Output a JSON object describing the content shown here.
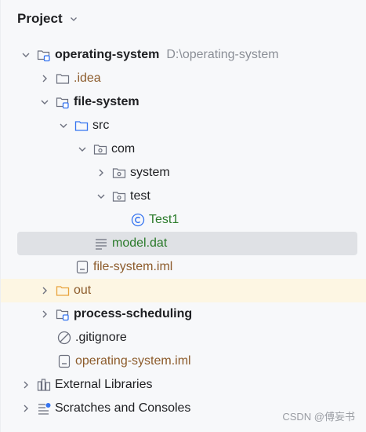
{
  "header": {
    "title": "Project"
  },
  "tree": {
    "root_label": "operating-system",
    "root_path": "D:\\operating-system",
    "idea_label": ".idea",
    "filesystem_label": "file-system",
    "src_label": "src",
    "com_label": "com",
    "system_label": "system",
    "test_label": "test",
    "test1_label": "Test1",
    "modeldat_label": "model.dat",
    "filesystem_iml_label": "file-system.iml",
    "out_label": "out",
    "process_label": "process-scheduling",
    "gitignore_label": ".gitignore",
    "os_iml_label": "operating-system.iml",
    "extlib_label": "External Libraries",
    "scratches_label": "Scratches and Consoles"
  },
  "watermark": "CSDN @傅妄书",
  "colors": {
    "selected_row": "#dfe1e5",
    "highlight_row": "#fdf6e3",
    "module_badge": "#3574f0",
    "excluded_folder": "#e8a33d",
    "class_icon": "#3574f0",
    "brown_text": "#8c5b2b",
    "green_text": "#2a7a2a"
  }
}
